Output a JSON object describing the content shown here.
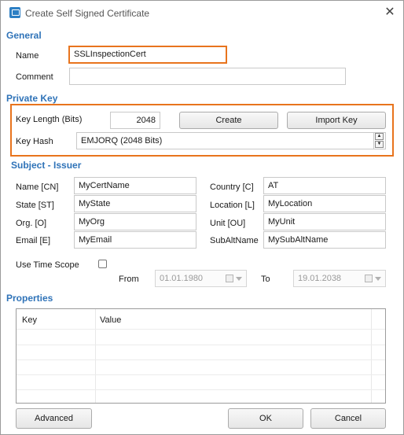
{
  "window": {
    "title": "Create Self Signed Certificate",
    "close": "✕"
  },
  "general": {
    "title": "General",
    "name_label": "Name",
    "name_value": "SSLInspectionCert",
    "comment_label": "Comment",
    "comment_value": ""
  },
  "private_key": {
    "title": "Private Key",
    "key_length_label": "Key Length (Bits)",
    "key_length_value": "2048",
    "create_label": "Create",
    "import_label": "Import Key",
    "key_hash_label": "Key Hash",
    "key_hash_value": "EMJORQ (2048 Bits)"
  },
  "subject": {
    "title": "Subject - Issuer",
    "fields": [
      {
        "label": "Name [CN]",
        "value": "MyCertName"
      },
      {
        "label": "State [ST]",
        "value": "MyState"
      },
      {
        "label": "Org. [O]",
        "value": "MyOrg"
      },
      {
        "label": "Email [E]",
        "value": "MyEmail"
      },
      {
        "label": "Country [C]",
        "value": "AT"
      },
      {
        "label": "Location [L]",
        "value": "MyLocation"
      },
      {
        "label": "Unit [OU]",
        "value": "MyUnit"
      },
      {
        "label": "SubAltName",
        "value": "MySubAltName"
      }
    ]
  },
  "time_scope": {
    "label": "Use Time Scope",
    "checked": false,
    "from_label": "From",
    "from_value": "01.01.1980",
    "to_label": "To",
    "to_value": "19.01.2038"
  },
  "properties": {
    "title": "Properties",
    "columns": [
      "Key",
      "Value"
    ],
    "rows": []
  },
  "footer": {
    "advanced_label": "Advanced",
    "ok_label": "OK",
    "cancel_label": "Cancel"
  },
  "colors": {
    "accent": "#2f73b8",
    "highlight": "#e8741d"
  },
  "icons": {
    "app": "certificate-app-icon",
    "close": "close-icon"
  }
}
